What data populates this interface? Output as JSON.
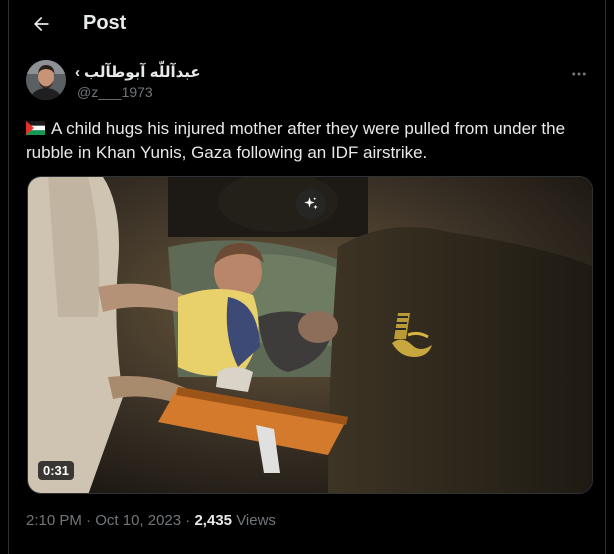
{
  "header": {
    "title": "Post",
    "back_icon": "arrow-left-icon"
  },
  "author": {
    "display_name": "عبدآللّه آبوطآلب",
    "name_suffix": "‹",
    "handle": "@z___1973",
    "avatar_icon": "user-avatar"
  },
  "post": {
    "text": "A child hugs his injured mother after they were pulled from under the rubble in Khan Yunis, Gaza following an IDF airstrike.",
    "flag_icon": "palestine-flag-icon"
  },
  "media": {
    "duration": "0:31",
    "grok_icon": "sparkle-icon",
    "watermark_icon": "channel-logo-watermark"
  },
  "meta": {
    "time": "2:10 PM",
    "separator": "·",
    "date": "Oct 10, 2023",
    "views_count": "2,435",
    "views_label": "Views"
  },
  "colors": {
    "background": "#000000",
    "text": "#e7e9ea",
    "muted": "#71767b",
    "border": "#2f3336"
  }
}
